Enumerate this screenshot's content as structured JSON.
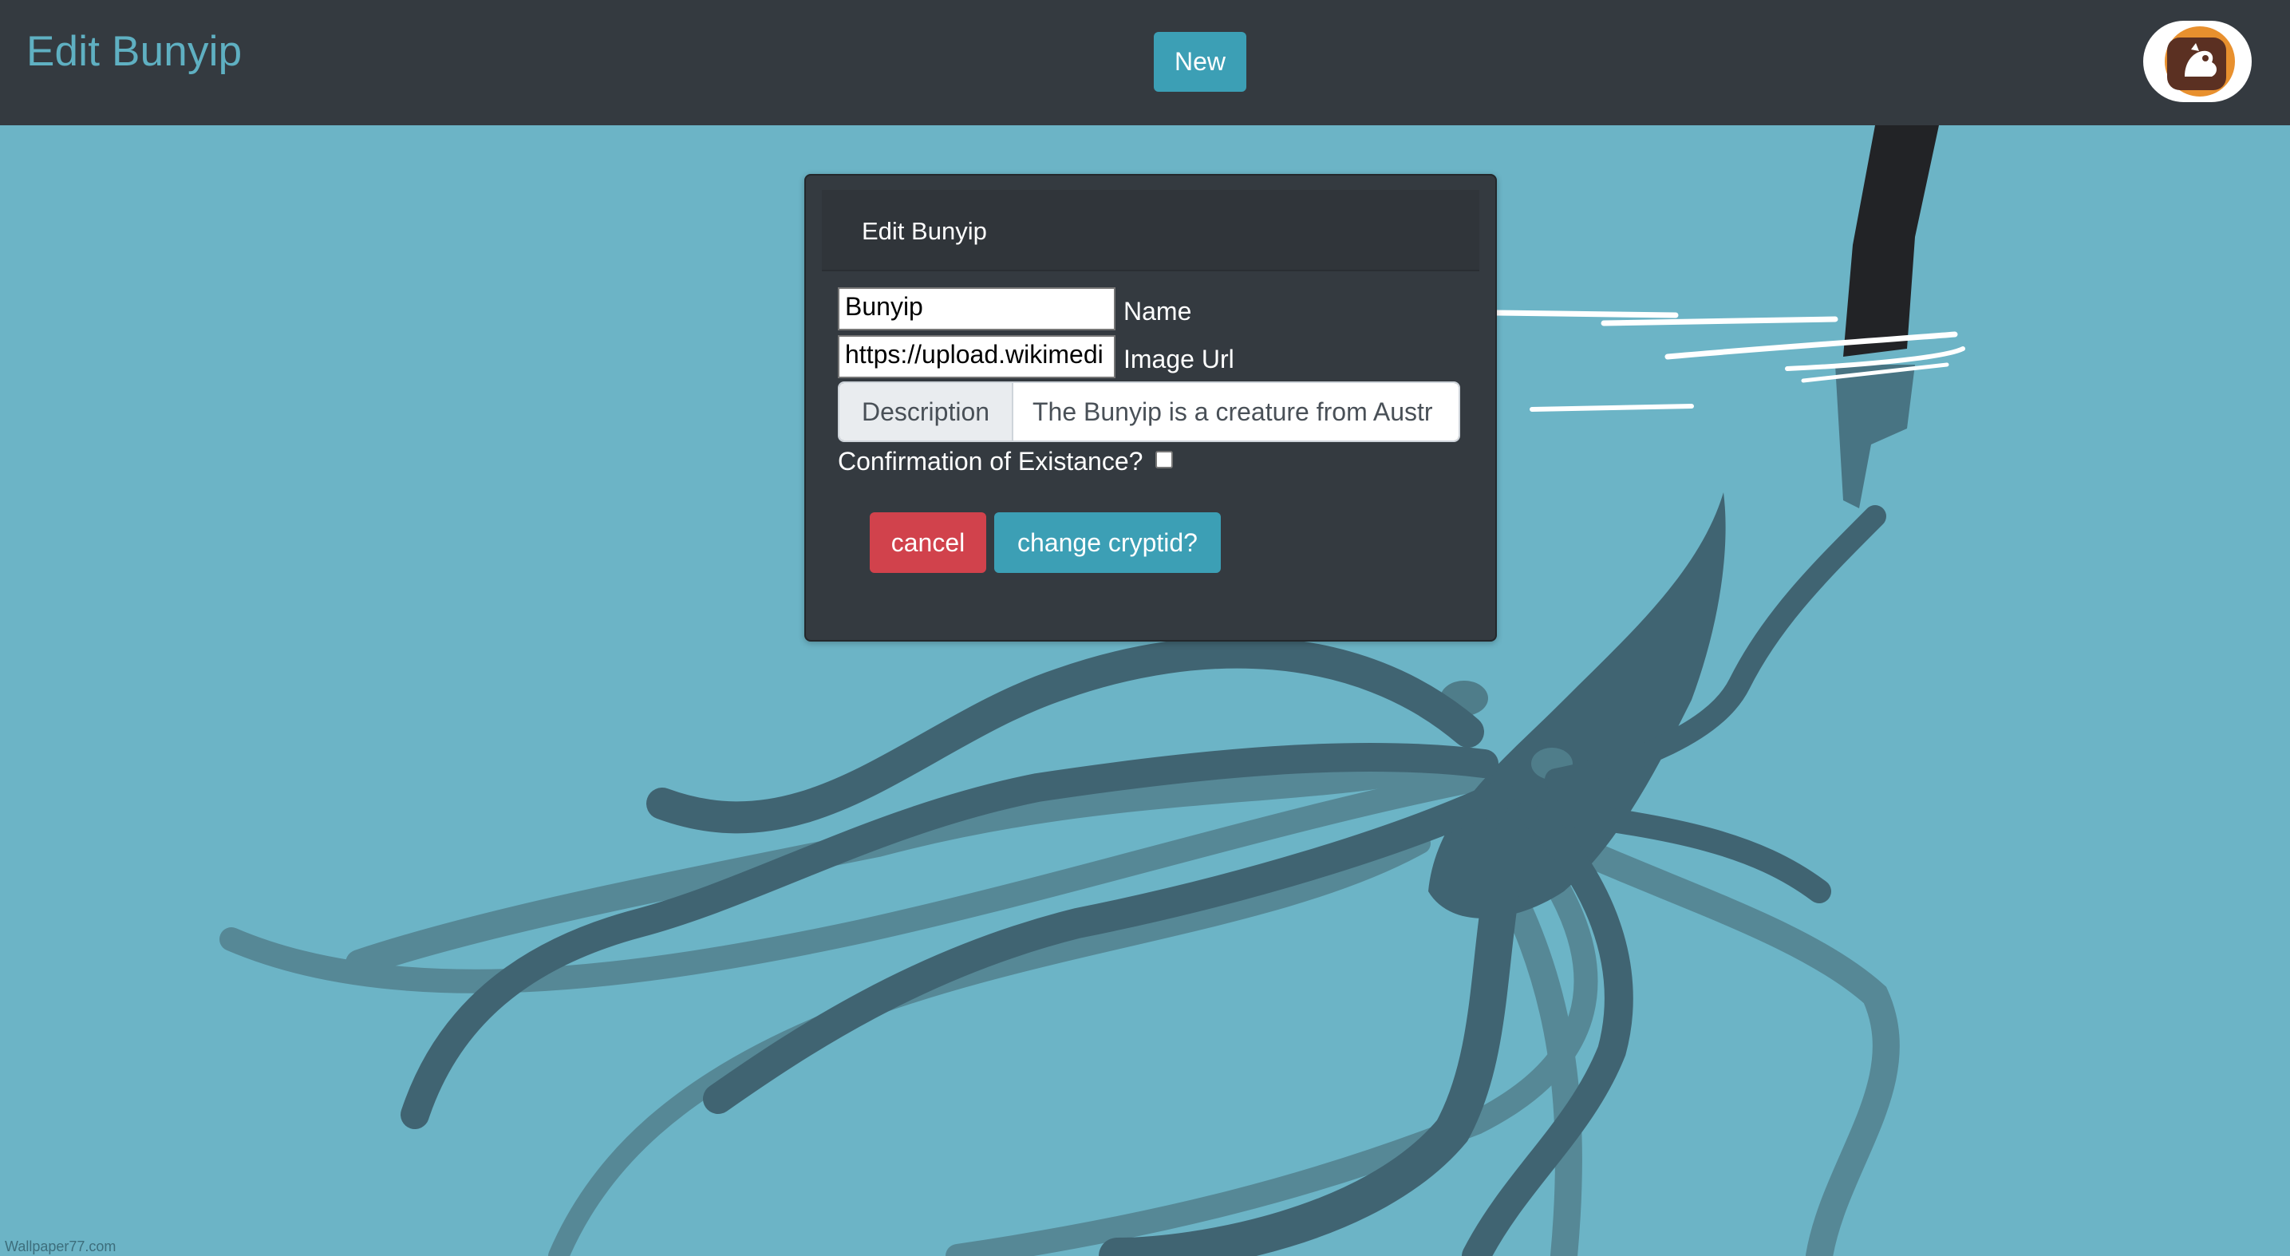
{
  "navbar": {
    "brand": "Edit Bunyip",
    "new_button": "New",
    "avatar_icon": "cryptid-logo-icon"
  },
  "form": {
    "header": "Edit Bunyip",
    "name_value": "Bunyip",
    "name_label": "Name",
    "image_url_value": "https://upload.wikimedi",
    "image_url_label": "Image Url",
    "description_prepend": "Description",
    "description_value": "The Bunyip is a creature from Austr",
    "confirmation_label": "Confirmation of Existance?",
    "confirmation_checked": false,
    "cancel_button": "cancel",
    "submit_button": "change cryptid?"
  },
  "background": {
    "watermark": "Wallpaper77.com",
    "colors": {
      "water": "#6cb4c6",
      "kraken": "#406472",
      "kraken_shadow": "#568896",
      "pole": "#222326"
    }
  },
  "colors": {
    "navbar": "#343a40",
    "brand": "#5fb0c2",
    "info": "#3c9fb5",
    "danger": "#d1424c",
    "card": "#343a40"
  }
}
